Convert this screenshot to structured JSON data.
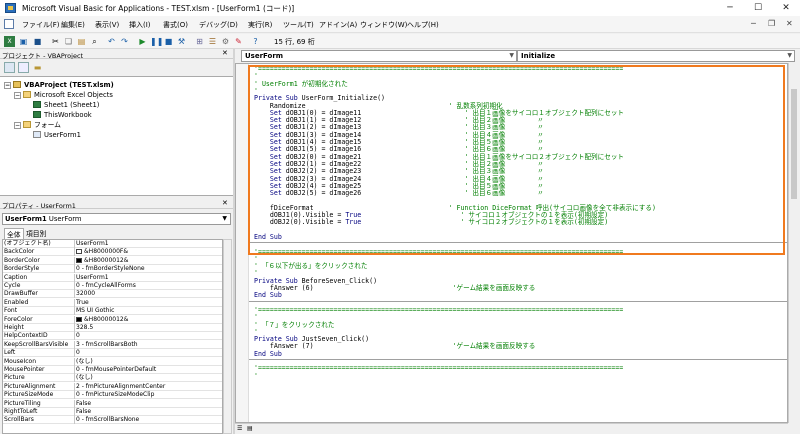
{
  "window": {
    "title": "Microsoft Visual Basic for Applications - TEST.xlsm - [UserForm1 (コード)]",
    "minimize": "─",
    "maximize": "☐",
    "close": "✕"
  },
  "menu": [
    "ファイル(F)",
    "編集(E)",
    "表示(V)",
    "挿入(I)",
    "書式(O)",
    "デバッグ(D)",
    "実行(R)",
    "ツール(T)",
    "アドイン(A)",
    "ウィンドウ(W)",
    "ヘルプ(H)"
  ],
  "toolbar": {
    "caret_position": "15 行, 69 桁"
  },
  "project": {
    "header": "プロジェクト - VBAProject",
    "tree": [
      {
        "label": "VBAProject (TEST.xlsm)",
        "level": 0
      },
      {
        "label": "Microsoft Excel Objects",
        "level": 1
      },
      {
        "label": "Sheet1 (Sheet1)",
        "level": 2
      },
      {
        "label": "ThisWorkbook",
        "level": 2
      },
      {
        "label": "フォーム",
        "level": 1
      },
      {
        "label": "UserForm1",
        "level": 2
      }
    ]
  },
  "properties": {
    "header": "プロパティ - UserForm1",
    "object_name": "UserForm1",
    "object_type": "UserForm",
    "tabs": [
      "全体",
      "項目別"
    ],
    "rows": [
      {
        "name": "(オブジェクト名)",
        "value": "UserForm1"
      },
      {
        "name": "BackColor",
        "value": "&H8000000F&",
        "swatch": "#ffffff"
      },
      {
        "name": "BorderColor",
        "value": "&H80000012&",
        "swatch": "#000000"
      },
      {
        "name": "BorderStyle",
        "value": "0 - fmBorderStyleNone"
      },
      {
        "name": "Caption",
        "value": "UserForm1"
      },
      {
        "name": "Cycle",
        "value": "0 - fmCycleAllForms"
      },
      {
        "name": "DrawBuffer",
        "value": "32000"
      },
      {
        "name": "Enabled",
        "value": "True"
      },
      {
        "name": "Font",
        "value": "MS UI Gothic"
      },
      {
        "name": "ForeColor",
        "value": "&H80000012&",
        "swatch": "#000000"
      },
      {
        "name": "Height",
        "value": "328.5"
      },
      {
        "name": "HelpContextID",
        "value": "0"
      },
      {
        "name": "KeepScrollBarsVisible",
        "value": "3 - fmScrollBarsBoth"
      },
      {
        "name": "Left",
        "value": "0"
      },
      {
        "name": "MouseIcon",
        "value": "(なし)"
      },
      {
        "name": "MousePointer",
        "value": "0 - fmMousePointerDefault"
      },
      {
        "name": "Picture",
        "value": "(なし)"
      },
      {
        "name": "PictureAlignment",
        "value": "2 - fmPictureAlignmentCenter"
      },
      {
        "name": "PictureSizeMode",
        "value": "0 - fmPictureSizeModeClip"
      },
      {
        "name": "PictureTiling",
        "value": "False"
      },
      {
        "name": "RightToLeft",
        "value": "False"
      },
      {
        "name": "ScrollBars",
        "value": "0 - fmScrollBarsNone"
      }
    ]
  },
  "code": {
    "object_combo": "UserForm",
    "proc_combo": "Initialize",
    "lines": [
      [
        [
          "cm",
          "'============================================================================================"
        ]
      ],
      [
        [
          "cm",
          "'"
        ]
      ],
      [
        [
          "cm",
          "' UserForm1 が初期化された"
        ]
      ],
      [
        [
          "cm",
          "'"
        ]
      ],
      [
        [
          "kw",
          "Private Sub "
        ],
        [
          "pl",
          "UserForm_Initialize()"
        ]
      ],
      [
        [
          "pl",
          "    Randomize                                    "
        ],
        [
          "cm",
          "' 乱数系列初期化"
        ]
      ],
      [
        [
          "kw",
          "    Set "
        ],
        [
          "pl",
          "dOBJ1(0) = dImage11                          "
        ],
        [
          "cm",
          "' 出目１画像をサイコロ１オブジェクト配列にセット"
        ]
      ],
      [
        [
          "kw",
          "    Set "
        ],
        [
          "pl",
          "dOBJ1(1) = dImage12                          "
        ],
        [
          "cm",
          "' 出目２画像        〃"
        ]
      ],
      [
        [
          "kw",
          "    Set "
        ],
        [
          "pl",
          "dOBJ1(2) = dImage13                          "
        ],
        [
          "cm",
          "' 出目３画像        〃"
        ]
      ],
      [
        [
          "kw",
          "    Set "
        ],
        [
          "pl",
          "dOBJ1(3) = dImage14                          "
        ],
        [
          "cm",
          "' 出目４画像        〃"
        ]
      ],
      [
        [
          "kw",
          "    Set "
        ],
        [
          "pl",
          "dOBJ1(4) = dImage15                          "
        ],
        [
          "cm",
          "' 出目５画像        〃"
        ]
      ],
      [
        [
          "kw",
          "    Set "
        ],
        [
          "pl",
          "dOBJ1(5) = dImage16                          "
        ],
        [
          "cm",
          "' 出目６画像        〃"
        ]
      ],
      [
        [
          "kw",
          "    Set "
        ],
        [
          "pl",
          "dOBJ2(0) = dImage21                          "
        ],
        [
          "cm",
          "' 出目１画像をサイコロ２オブジェクト配列にセット"
        ]
      ],
      [
        [
          "kw",
          "    Set "
        ],
        [
          "pl",
          "dOBJ2(1) = dImage22                          "
        ],
        [
          "cm",
          "' 出目２画像        〃"
        ]
      ],
      [
        [
          "kw",
          "    Set "
        ],
        [
          "pl",
          "dOBJ2(2) = dImage23                          "
        ],
        [
          "cm",
          "' 出目３画像        〃"
        ]
      ],
      [
        [
          "kw",
          "    Set "
        ],
        [
          "pl",
          "dOBJ2(3) = dImage24                          "
        ],
        [
          "cm",
          "' 出目４画像        〃"
        ]
      ],
      [
        [
          "kw",
          "    Set "
        ],
        [
          "pl",
          "dOBJ2(4) = dImage25                          "
        ],
        [
          "cm",
          "' 出目５画像        〃"
        ]
      ],
      [
        [
          "kw",
          "    Set "
        ],
        [
          "pl",
          "dOBJ2(5) = dImage26                          "
        ],
        [
          "cm",
          "' 出目６画像        〃"
        ]
      ],
      [
        [
          "pl",
          ""
        ]
      ],
      [
        [
          "pl",
          "    fDiceFormat                                  "
        ],
        [
          "cm",
          "' Function DiceFormat 呼出(サイコロ画像を全て非表示にする)"
        ]
      ],
      [
        [
          "pl",
          "    dOBJ1(0).Visible = "
        ],
        [
          "kw",
          "True                         "
        ],
        [
          "cm",
          "' サイコロ１オブジェクトの１を表示(初期設定)"
        ]
      ],
      [
        [
          "pl",
          "    dOBJ2(0).Visible = "
        ],
        [
          "kw",
          "True                         "
        ],
        [
          "cm",
          "' サイコロ２オブジェクトの１を表示(初期設定)"
        ]
      ],
      [
        [
          "pl",
          ""
        ]
      ],
      [
        [
          "kw",
          "End Sub"
        ]
      ],
      [
        [
          "pl",
          ""
        ]
      ],
      [
        [
          "cm",
          "'============================================================================================"
        ]
      ],
      [
        [
          "cm",
          "'"
        ]
      ],
      [
        [
          "cm",
          "' 「６以下が出る」をクリックされた"
        ]
      ],
      [
        [
          "cm",
          "'"
        ]
      ],
      [
        [
          "kw",
          "Private Sub "
        ],
        [
          "pl",
          "BeforeSeven_Click()"
        ]
      ],
      [
        [
          "pl",
          "    fAnswer (6)                                   "
        ],
        [
          "cm",
          "'ゲーム結果を画面反映する"
        ]
      ],
      [
        [
          "kw",
          "End Sub"
        ]
      ],
      [
        [
          "pl",
          ""
        ]
      ],
      [
        [
          "cm",
          "'============================================================================================"
        ]
      ],
      [
        [
          "cm",
          "'"
        ]
      ],
      [
        [
          "cm",
          "' 「７」をクリックされた"
        ]
      ],
      [
        [
          "cm",
          "'"
        ]
      ],
      [
        [
          "kw",
          "Private Sub "
        ],
        [
          "pl",
          "JustSeven_Click()"
        ]
      ],
      [
        [
          "pl",
          "    fAnswer (7)                                   "
        ],
        [
          "cm",
          "'ゲーム結果を画面反映する"
        ]
      ],
      [
        [
          "kw",
          "End Sub"
        ]
      ],
      [
        [
          "pl",
          ""
        ]
      ],
      [
        [
          "cm",
          "'============================================================================================"
        ]
      ],
      [
        [
          "cm",
          "'"
        ]
      ]
    ]
  }
}
